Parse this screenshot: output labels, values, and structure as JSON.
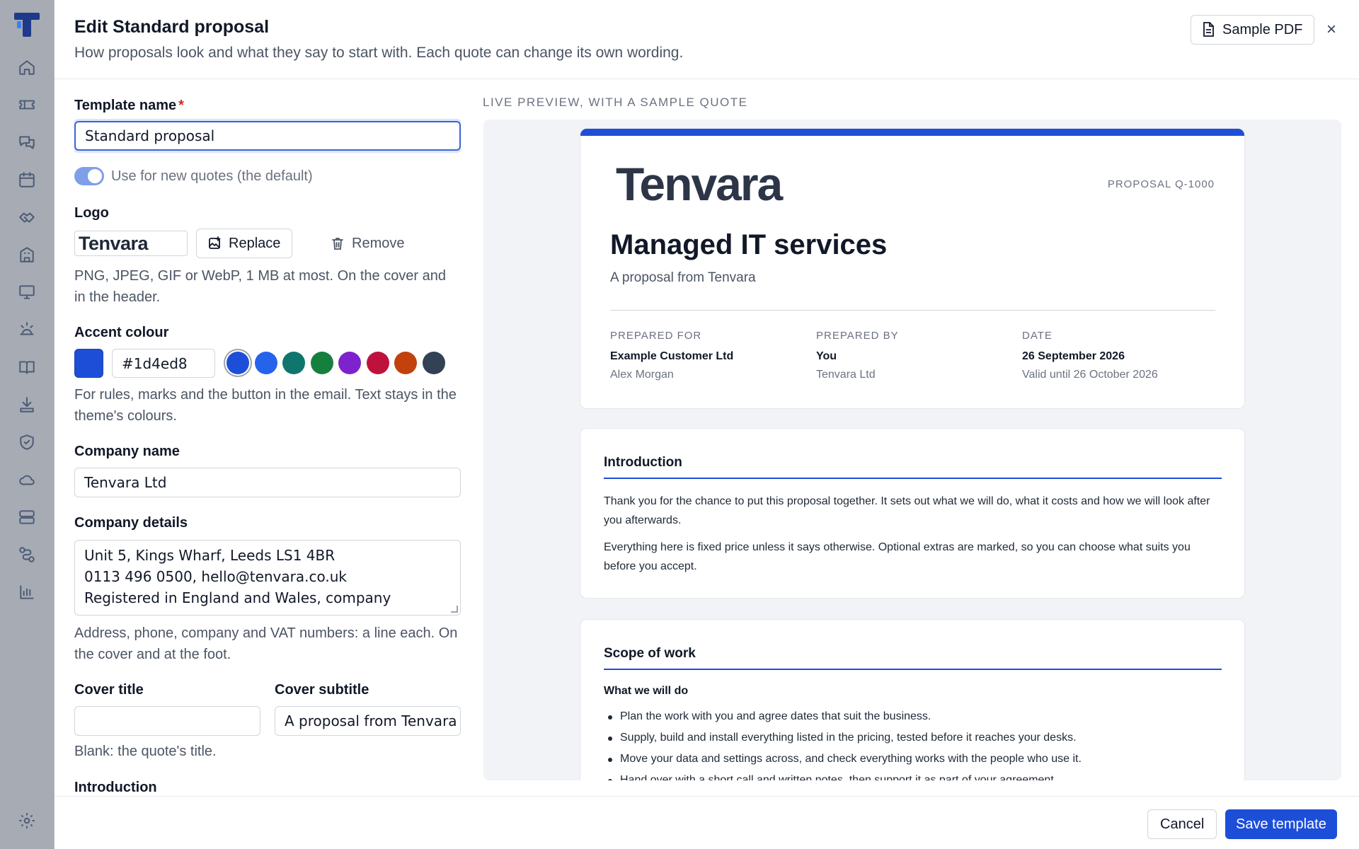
{
  "modal": {
    "title": "Edit Standard proposal",
    "subtitle": "How proposals look and what they say to start with. Each quote can change its own wording.",
    "sample_pdf_label": "Sample PDF",
    "close_glyph": "×"
  },
  "form": {
    "template_name_label": "Template name",
    "required_mark": "*",
    "template_name_value": "Standard proposal",
    "default_toggle": {
      "label": "Use for new quotes (the default)",
      "on": true
    },
    "logo_label": "Logo",
    "logo_preview_text": "Tenvara",
    "replace_label": "Replace",
    "remove_label": "Remove",
    "logo_help": "PNG, JPEG, GIF or WebP, 1 MB at most. On the cover and in the header.",
    "accent_label": "Accent colour",
    "accent_value": "#1d4ed8",
    "accent_swatches": [
      "#1d4ed8",
      "#2563eb",
      "#0f766e",
      "#15803d",
      "#7e22ce",
      "#be123c",
      "#c2410c",
      "#334155"
    ],
    "accent_help": "For rules, marks and the button in the email. Text stays in the theme's colours.",
    "company_name_label": "Company name",
    "company_name_value": "Tenvara Ltd",
    "company_details_label": "Company details",
    "company_details_lines": [
      "Unit 5, Kings Wharf, Leeds LS1 4BR",
      "0113 496 0500, hello@tenvara.co.uk",
      "Registered in England and Wales, company"
    ],
    "company_details_help": "Address, phone, company and VAT numbers: a line each. On the cover and at the foot.",
    "cover_title_label": "Cover title",
    "cover_title_value": "",
    "cover_subtitle_label": "Cover subtitle",
    "cover_subtitle_value": "A proposal from Tenvara",
    "cover_title_help": "Blank: the quote's title.",
    "introduction_label": "Introduction"
  },
  "preview": {
    "label": "LIVE PREVIEW, WITH A SAMPLE QUOTE",
    "cover": {
      "logo_text": "Tenvara",
      "proposal_ref": "PROPOSAL Q-1000",
      "title": "Managed IT services",
      "subtitle": "A proposal from Tenvara",
      "prepared_for": {
        "heading": "PREPARED FOR",
        "name": "Example Customer Ltd",
        "detail": "Alex Morgan"
      },
      "prepared_by": {
        "heading": "PREPARED BY",
        "name": "You",
        "detail": "Tenvara Ltd"
      },
      "date": {
        "heading": "DATE",
        "value": "26 September 2026",
        "detail": "Valid until 26 October 2026"
      }
    },
    "introduction": {
      "title": "Introduction",
      "paragraphs": [
        "Thank you for the chance to put this proposal together. It sets out what we will do, what it costs and how we will look after you afterwards.",
        "Everything here is fixed price unless it says otherwise. Optional extras are marked, so you can choose what suits you before you accept."
      ]
    },
    "scope": {
      "title": "Scope of work",
      "subheading": "What we will do",
      "items": [
        "Plan the work with you and agree dates that suit the business.",
        "Supply, build and install everything listed in the pricing, tested before it reaches your desks.",
        "Move your data and settings across, and check everything works with the people who use it.",
        "Hand over with a short call and written notes, then support it as part of your agreement."
      ]
    }
  },
  "footer": {
    "cancel_label": "Cancel",
    "save_label": "Save template"
  },
  "sidebar": {
    "icons": [
      "home-icon",
      "ticket-icon",
      "chat-icon",
      "calendar-icon",
      "handshake-icon",
      "building-icon",
      "monitor-icon",
      "alert-icon",
      "book-icon",
      "download-icon",
      "shield-icon",
      "cloud-icon",
      "server-icon",
      "workflow-icon",
      "chart-icon"
    ],
    "bottom_icon": "gear-icon"
  }
}
